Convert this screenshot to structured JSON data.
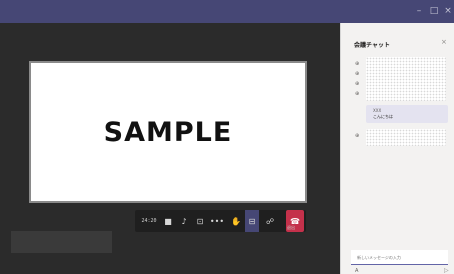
{
  "window": {
    "minimize_glyph": "–",
    "maximize_glyph": "□",
    "close_glyph": "×"
  },
  "stage": {
    "video_text": "SAMPLE"
  },
  "toolbar": {
    "timer": "24:20",
    "camera_icon": "■",
    "mic_icon": "♪",
    "share_icon": "⊡",
    "more_icon": "•••",
    "raise_hand_icon": "✋",
    "chat_icon": "⊟",
    "people_icon": "☍",
    "hangup_icon": "☎",
    "leave_label": "退出"
  },
  "chat": {
    "title": "会議チャット",
    "close": "×",
    "participant_icon": "⊕",
    "message_sender": "XXX",
    "message_text": "こんにちは",
    "compose_placeholder": "新しいメッセージの入力",
    "format_icon": "A",
    "send_icon": "▷"
  }
}
